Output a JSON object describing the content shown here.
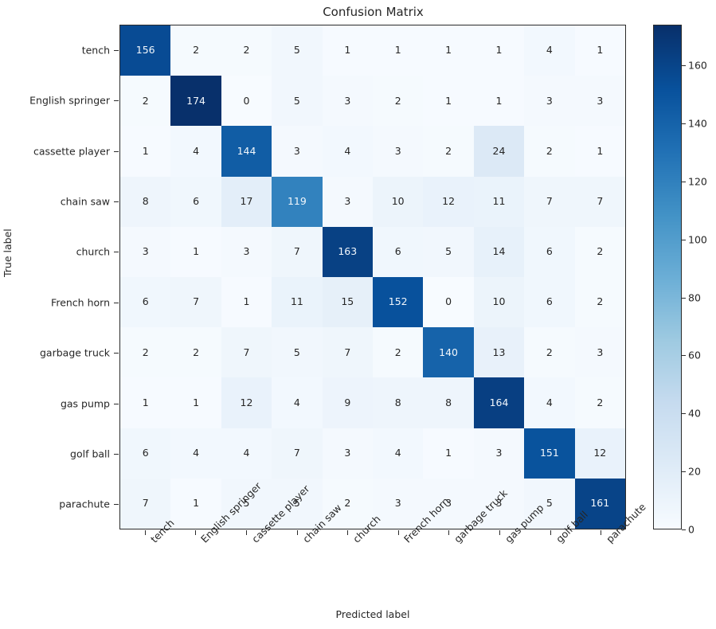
{
  "chart_data": {
    "type": "heatmap",
    "title": "Confusion Matrix",
    "xlabel": "Predicted label",
    "ylabel": "True label",
    "categories": [
      "tench",
      "English springer",
      "cassette player",
      "chain saw",
      "church",
      "French horn",
      "garbage truck",
      "gas pump",
      "golf ball",
      "parachute"
    ],
    "x_tick_labels": [
      "tench",
      "English springer",
      "cassette player",
      "chain saw",
      "church",
      "French horn",
      "garbage truck",
      "gas pump",
      "golf ball",
      "parachute"
    ],
    "y_tick_labels": [
      "tench",
      "English springer",
      "cassette player",
      "chain saw",
      "church",
      "French horn",
      "garbage truck",
      "gas pump",
      "golf ball",
      "parachute"
    ],
    "matrix": [
      [
        156,
        2,
        2,
        5,
        1,
        1,
        1,
        1,
        4,
        1
      ],
      [
        2,
        174,
        0,
        5,
        3,
        2,
        1,
        1,
        3,
        3
      ],
      [
        1,
        4,
        144,
        3,
        4,
        3,
        2,
        24,
        2,
        1
      ],
      [
        8,
        6,
        17,
        119,
        3,
        10,
        12,
        11,
        7,
        7
      ],
      [
        3,
        1,
        3,
        7,
        163,
        6,
        5,
        14,
        6,
        2
      ],
      [
        6,
        7,
        1,
        11,
        15,
        152,
        0,
        10,
        6,
        2
      ],
      [
        2,
        2,
        7,
        5,
        7,
        2,
        140,
        13,
        2,
        3
      ],
      [
        1,
        1,
        12,
        4,
        9,
        8,
        8,
        164,
        4,
        2
      ],
      [
        6,
        4,
        4,
        7,
        3,
        4,
        1,
        3,
        151,
        12
      ],
      [
        7,
        1,
        5,
        5,
        2,
        3,
        3,
        3,
        5,
        161
      ]
    ],
    "colormap": "Blues",
    "vmin": 0,
    "vmax": 174,
    "colorbar": {
      "ticks": [
        0,
        20,
        40,
        60,
        80,
        100,
        120,
        140,
        160
      ],
      "tick_labels": [
        "0",
        "20",
        "40",
        "60",
        "80",
        "100",
        "120",
        "140",
        "160"
      ],
      "position": "right"
    },
    "grid": false,
    "legend": false,
    "text_color_dark": "#262626",
    "text_color_light": "#f2f7fc",
    "accent_color": "#08306b"
  }
}
